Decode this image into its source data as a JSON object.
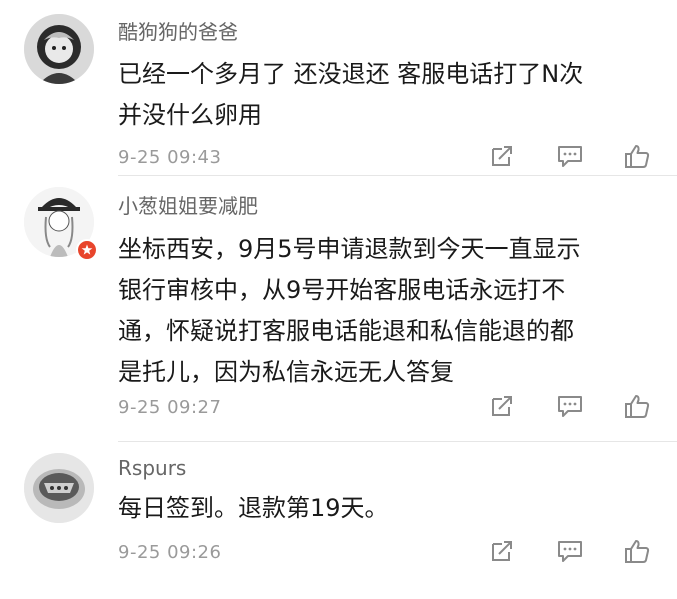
{
  "comments": [
    {
      "username": "酷狗狗的爸爸",
      "lines": [
        "已经一个多月了 还没退还 客服电话打了N次",
        "并没什么卵用"
      ],
      "time": "9-25 09:43"
    },
    {
      "username": "小葱姐姐要减肥",
      "lines": [
        "坐标西安，9月5号申请退款到今天一直显示",
        "银行审核中，从9号开始客服电话永远打不",
        "通，怀疑说打客服电话能退和私信能退的都",
        "是托儿，因为私信永远无人答复"
      ],
      "time": "9-25 09:27"
    },
    {
      "username": "Rspurs",
      "lines": [
        "每日签到。退款第19天。"
      ],
      "time": "9-25 09:26"
    }
  ],
  "icons": {
    "share": "share-icon",
    "reply": "comment-icon",
    "like": "thumbs-up-icon",
    "badge": "star-icon"
  },
  "colors": {
    "username": "#666666",
    "text": "#1a1a1a",
    "time": "#9a9a9a",
    "icon": "#8a8a8a",
    "badge": "#e8452c"
  }
}
